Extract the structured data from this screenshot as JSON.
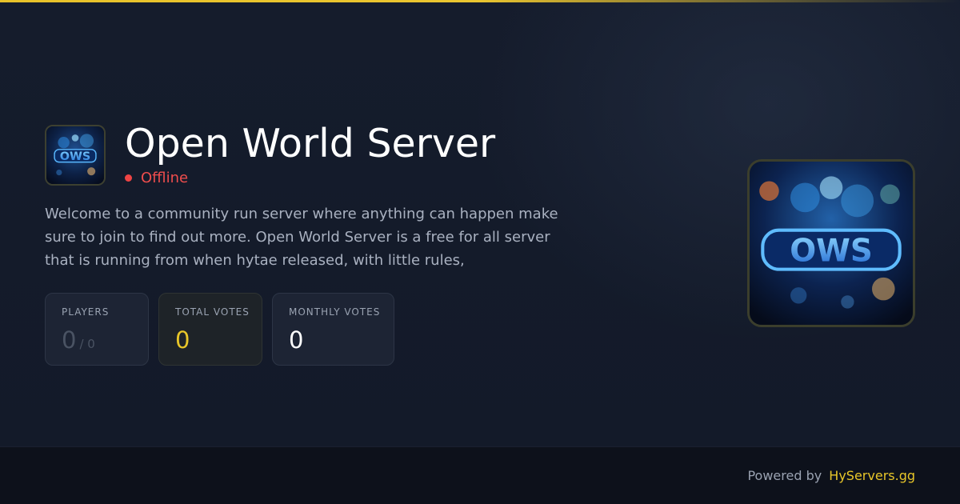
{
  "server": {
    "name": "Open World Server",
    "status": "Offline",
    "status_color": "#ef4444",
    "logo_text": "OWS",
    "description": "Welcome to a community run server where anything can happen make sure to join to find out more. Open World Server is a free for all server that is running from when hytae released, with little rules,"
  },
  "stats": {
    "players": {
      "label": "PLAYERS",
      "value": "0",
      "max": "/ 0"
    },
    "total_votes": {
      "label": "TOTAL VOTES",
      "value": "0"
    },
    "monthly_votes": {
      "label": "MONTHLY VOTES",
      "value": "0"
    }
  },
  "footer": {
    "powered_label": "Powered by",
    "brand": "HyServers.gg"
  },
  "colors": {
    "accent": "#e8c629",
    "background": "#141b2b",
    "footer_bg": "#0d111b",
    "offline": "#ef4444"
  }
}
